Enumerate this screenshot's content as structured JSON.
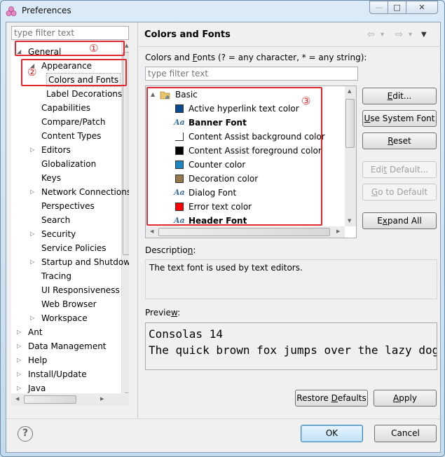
{
  "window": {
    "title": "Preferences",
    "minimize": "—",
    "maximize": "□",
    "close": "✕"
  },
  "left": {
    "filter_placeholder": "type filter text",
    "tree": [
      {
        "label": "General",
        "level": 0,
        "toggle": "▲"
      },
      {
        "label": "Appearance",
        "level": 1,
        "toggle": "▲"
      },
      {
        "label": "Colors and Fonts",
        "level": 2,
        "toggle": "",
        "selected": true
      },
      {
        "label": "Label Decorations",
        "level": 2,
        "toggle": ""
      },
      {
        "label": "Capabilities",
        "level": 1,
        "toggle": ""
      },
      {
        "label": "Compare/Patch",
        "level": 1,
        "toggle": ""
      },
      {
        "label": "Content Types",
        "level": 1,
        "toggle": ""
      },
      {
        "label": "Editors",
        "level": 1,
        "toggle": "▷"
      },
      {
        "label": "Globalization",
        "level": 1,
        "toggle": ""
      },
      {
        "label": "Keys",
        "level": 1,
        "toggle": ""
      },
      {
        "label": "Network Connections",
        "level": 1,
        "toggle": "▷"
      },
      {
        "label": "Perspectives",
        "level": 1,
        "toggle": ""
      },
      {
        "label": "Search",
        "level": 1,
        "toggle": ""
      },
      {
        "label": "Security",
        "level": 1,
        "toggle": "▷"
      },
      {
        "label": "Service Policies",
        "level": 1,
        "toggle": ""
      },
      {
        "label": "Startup and Shutdown",
        "level": 1,
        "toggle": "▷"
      },
      {
        "label": "Tracing",
        "level": 1,
        "toggle": ""
      },
      {
        "label": "UI Responsiveness",
        "level": 1,
        "toggle": ""
      },
      {
        "label": "Web Browser",
        "level": 1,
        "toggle": ""
      },
      {
        "label": "Workspace",
        "level": 1,
        "toggle": "▷"
      },
      {
        "label": "Ant",
        "level": 0,
        "toggle": "▷"
      },
      {
        "label": "Data Management",
        "level": 0,
        "toggle": "▷"
      },
      {
        "label": "Help",
        "level": 0,
        "toggle": "▷"
      },
      {
        "label": "Install/Update",
        "level": 0,
        "toggle": "▷"
      },
      {
        "label": "Java",
        "level": 0,
        "toggle": "▷"
      }
    ]
  },
  "annotations": {
    "one": "①",
    "two": "②",
    "three": "③",
    "color": "#e0282e"
  },
  "page": {
    "title": "Colors and Fonts",
    "nav": {
      "back": "⇦",
      "back_menu": "▾",
      "forward": "⇨",
      "forward_menu": "▾",
      "view_menu": "▼"
    },
    "filter_label_pre": "Colors and ",
    "filter_label_mn": "F",
    "filter_label_post": "onts (? = any character, * = any string):",
    "filter_placeholder": "type filter text",
    "category": {
      "label": "Basic",
      "toggle": "▲"
    },
    "items": [
      {
        "label": "Active hyperlink text color",
        "type": "color",
        "color": "#0b4a8e"
      },
      {
        "label": "Banner Font",
        "type": "font",
        "bold": true
      },
      {
        "label": "Content Assist background color",
        "type": "color",
        "color": "#ffffff"
      },
      {
        "label": "Content Assist foreground color",
        "type": "color",
        "color": "#000000"
      },
      {
        "label": "Counter color",
        "type": "color",
        "color": "#1a86c2"
      },
      {
        "label": "Decoration color",
        "type": "color",
        "color": "#94784a"
      },
      {
        "label": "Dialog Font",
        "type": "font",
        "bold": false
      },
      {
        "label": "Error text color",
        "type": "color",
        "color": "#ff0000"
      },
      {
        "label": "Header Font",
        "type": "font",
        "bold": true
      }
    ],
    "font_icon": "Aa",
    "buttons": {
      "edit": [
        "",
        "E",
        "dit..."
      ],
      "use_system_font": [
        "",
        "U",
        "se System Font"
      ],
      "reset": [
        "",
        "R",
        "eset"
      ],
      "edit_default": [
        "Edi",
        "t",
        " Default..."
      ],
      "go_to_default": [
        "",
        "G",
        "o to Default"
      ],
      "expand_all": [
        "E",
        "x",
        "pand All"
      ]
    },
    "description_label": [
      "Descriptio",
      "n",
      ":"
    ],
    "description_text": "The text font is used by text editors.",
    "preview_label": [
      "Previe",
      "w",
      ":"
    ],
    "preview_line1": "Consolas 14",
    "preview_line2": "The quick brown fox jumps over the lazy dog.",
    "restore_defaults": [
      "Restore ",
      "D",
      "efaults"
    ],
    "apply": [
      "",
      "A",
      "pply"
    ]
  },
  "footer": {
    "help_icon": "?",
    "ok": "OK",
    "cancel": "Cancel"
  }
}
